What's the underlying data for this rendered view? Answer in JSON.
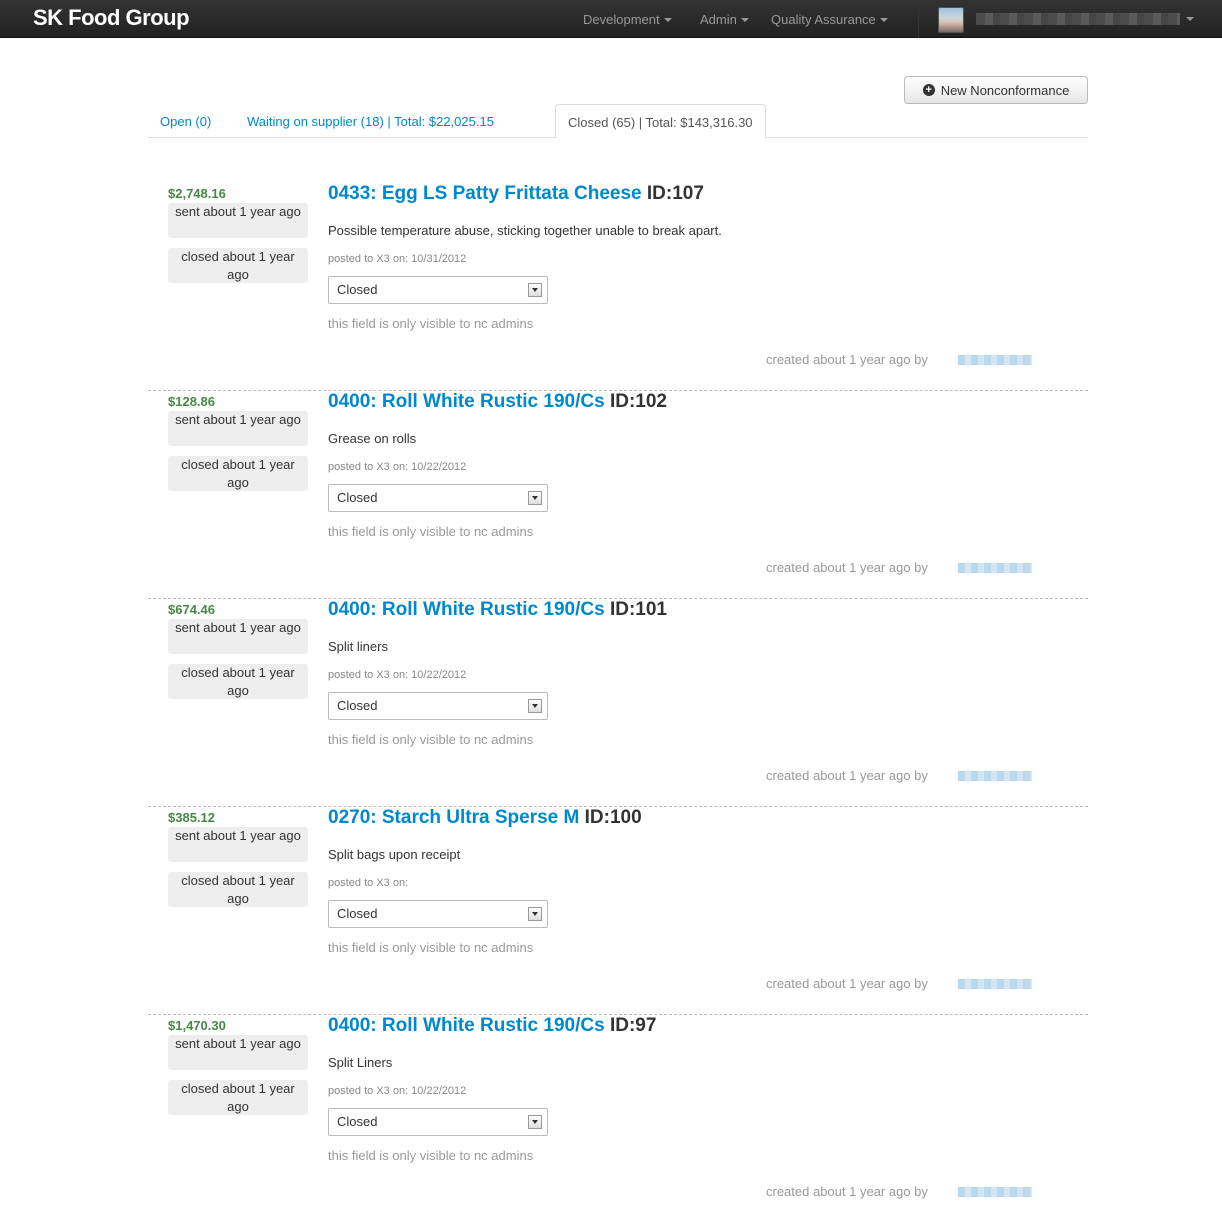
{
  "navbar": {
    "brand": "SK Food Group",
    "menus": [
      {
        "label": "Development"
      },
      {
        "label": "Admin"
      },
      {
        "label": "Quality Assurance"
      }
    ]
  },
  "actions": {
    "new_label": "New Nonconformance",
    "new_icon": "plus-circle-icon"
  },
  "tabs": [
    {
      "label": "Open (0)",
      "active": false
    },
    {
      "label": "Waiting on supplier (18) | Total: $22,025.15",
      "active": false
    },
    {
      "label": "Closed (65) | Total: $143,316.30",
      "active": true
    }
  ],
  "common": {
    "sent": "sent about 1 year ago",
    "closed": "closed about 1 year ago",
    "admin_note": "this field is only visible to nc admins",
    "created": "created about 1 year ago by"
  },
  "items": [
    {
      "amount": "$2,748.16",
      "name": "0433: Egg LS Patty Frittata Cheese",
      "id": "ID:107",
      "description": "Possible temperature abuse, sticking together unable to break apart.",
      "posted": "posted to X3 on: 10/31/2012",
      "status": "Closed"
    },
    {
      "amount": "$128.86",
      "name": "0400: Roll White Rustic 190/Cs",
      "id": "ID:102",
      "description": "Grease on rolls",
      "posted": "posted to X3 on: 10/22/2012",
      "status": "Closed"
    },
    {
      "amount": "$674.46",
      "name": "0400: Roll White Rustic 190/Cs",
      "id": "ID:101",
      "description": "Split liners",
      "posted": "posted to X3 on: 10/22/2012",
      "status": "Closed"
    },
    {
      "amount": "$385.12",
      "name": "0270: Starch Ultra Sperse M",
      "id": "ID:100",
      "description": "Split bags upon receipt",
      "posted": "posted to X3 on:",
      "status": "Closed"
    },
    {
      "amount": "$1,470.30",
      "name": "0400: Roll White Rustic 190/Cs",
      "id": "ID:97",
      "description": "Split Liners",
      "posted": "posted to X3 on: 10/22/2012",
      "status": "Closed"
    }
  ]
}
